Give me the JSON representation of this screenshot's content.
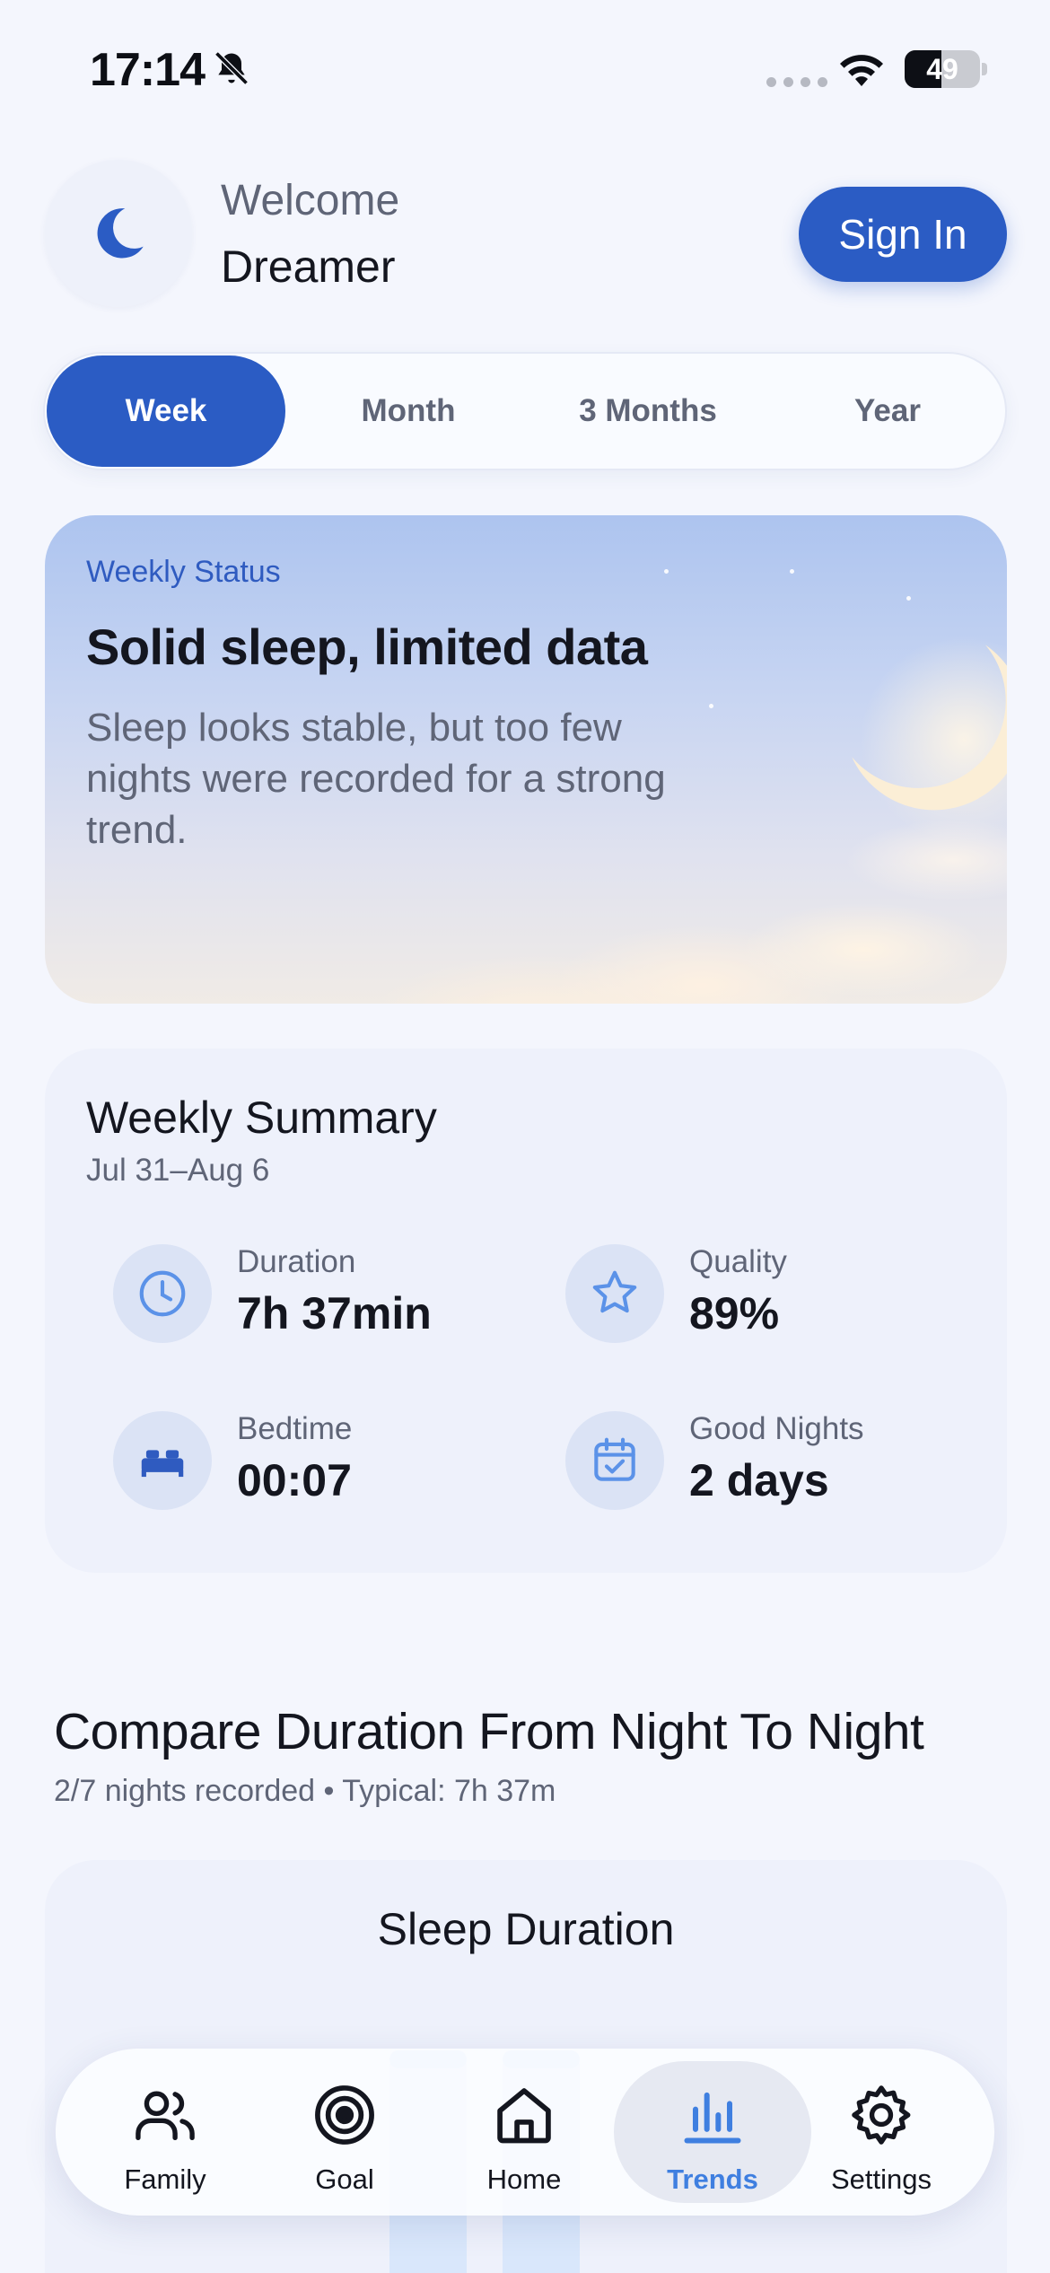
{
  "status_bar": {
    "time": "17:14",
    "battery": "49",
    "battery_level_pct": 49,
    "icons": [
      "bell-slash-icon",
      "signal-icon",
      "wifi-icon",
      "battery-icon"
    ]
  },
  "header": {
    "welcome": "Welcome",
    "name": "Dreamer",
    "sign_in": "Sign In",
    "avatar_icon": "moon-icon"
  },
  "period_tabs": [
    {
      "label": "Week",
      "active": true
    },
    {
      "label": "Month",
      "active": false
    },
    {
      "label": "3 Months",
      "active": false
    },
    {
      "label": "Year",
      "active": false
    }
  ],
  "weekly_status": {
    "eyebrow": "Weekly Status",
    "title": "Solid sleep, limited data",
    "description": "Sleep looks stable, but too few nights were recorded for a strong trend."
  },
  "summary": {
    "title": "Weekly Summary",
    "range": "Jul 31–Aug 6",
    "metrics": [
      {
        "label": "Duration",
        "value": "7h 37min",
        "icon": "clock-icon"
      },
      {
        "label": "Quality",
        "value": "89%",
        "icon": "star-icon"
      },
      {
        "label": "Bedtime",
        "value": "00:07",
        "icon": "bed-icon"
      },
      {
        "label": "Good Nights",
        "value": "2 days",
        "icon": "calendar-check-icon"
      }
    ]
  },
  "compare": {
    "title": "Compare Duration From Night To Night",
    "subtitle": "2/7 nights recorded • Typical: 7h 37m"
  },
  "chart": {
    "title": "Sleep Duration"
  },
  "nav": [
    {
      "label": "Family",
      "icon": "family-icon",
      "active": false
    },
    {
      "label": "Goal",
      "icon": "target-icon",
      "active": false
    },
    {
      "label": "Home",
      "icon": "home-icon",
      "active": false
    },
    {
      "label": "Trends",
      "icon": "bar-chart-icon",
      "active": true
    },
    {
      "label": "Settings",
      "icon": "gear-icon",
      "active": false
    }
  ],
  "colors": {
    "accent": "#2b5cc4",
    "active_nav": "#3f7fe0",
    "background": "#f4f6fd",
    "muted_text": "#5f6577"
  }
}
